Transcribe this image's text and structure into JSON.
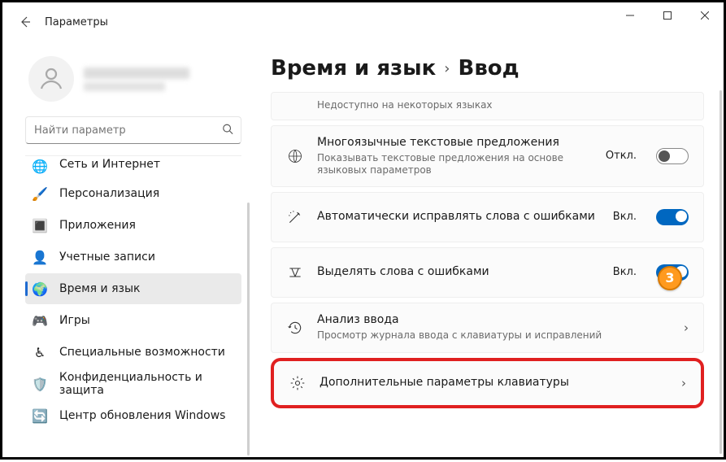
{
  "window": {
    "title": "Параметры"
  },
  "user": {
    "name_masked": true,
    "email_masked": true
  },
  "search": {
    "placeholder": "Найти параметр"
  },
  "sidebar": [
    {
      "label": "Сеть и Интернет",
      "icon": "🌐",
      "partial": true
    },
    {
      "label": "Персонализация",
      "icon": "🖌️"
    },
    {
      "label": "Приложения",
      "icon": "🔳"
    },
    {
      "label": "Учетные записи",
      "icon": "👤"
    },
    {
      "label": "Время и язык",
      "icon": "🌍",
      "selected": true
    },
    {
      "label": "Игры",
      "icon": "🎮"
    },
    {
      "label": "Специальные возможности",
      "icon": "♿"
    },
    {
      "label": "Конфиденциальность и защита",
      "icon": "🛡️"
    },
    {
      "label": "Центр обновления Windows",
      "icon": "🔄"
    }
  ],
  "breadcrumb": {
    "parent": "Время и язык",
    "current": "Ввод"
  },
  "cards": {
    "partial_note": "Недоступно на некоторых языках",
    "multilang": {
      "title": "Многоязычные текстовые предложения",
      "sub": "Показывать текстовые предложения на основе языковых параметров",
      "status": "Откл."
    },
    "autocorrect": {
      "title": "Автоматически исправлять слова с ошибками",
      "status": "Вкл."
    },
    "highlight_mis": {
      "title": "Выделять слова с ошибками",
      "status": "Вкл."
    },
    "analysis": {
      "title": "Анализ ввода",
      "sub": "Просмотр журнала ввода с клавиатуры и исправлений"
    },
    "advanced": {
      "title": "Дополнительные параметры клавиатуры"
    }
  },
  "annotation": {
    "step": "3"
  }
}
